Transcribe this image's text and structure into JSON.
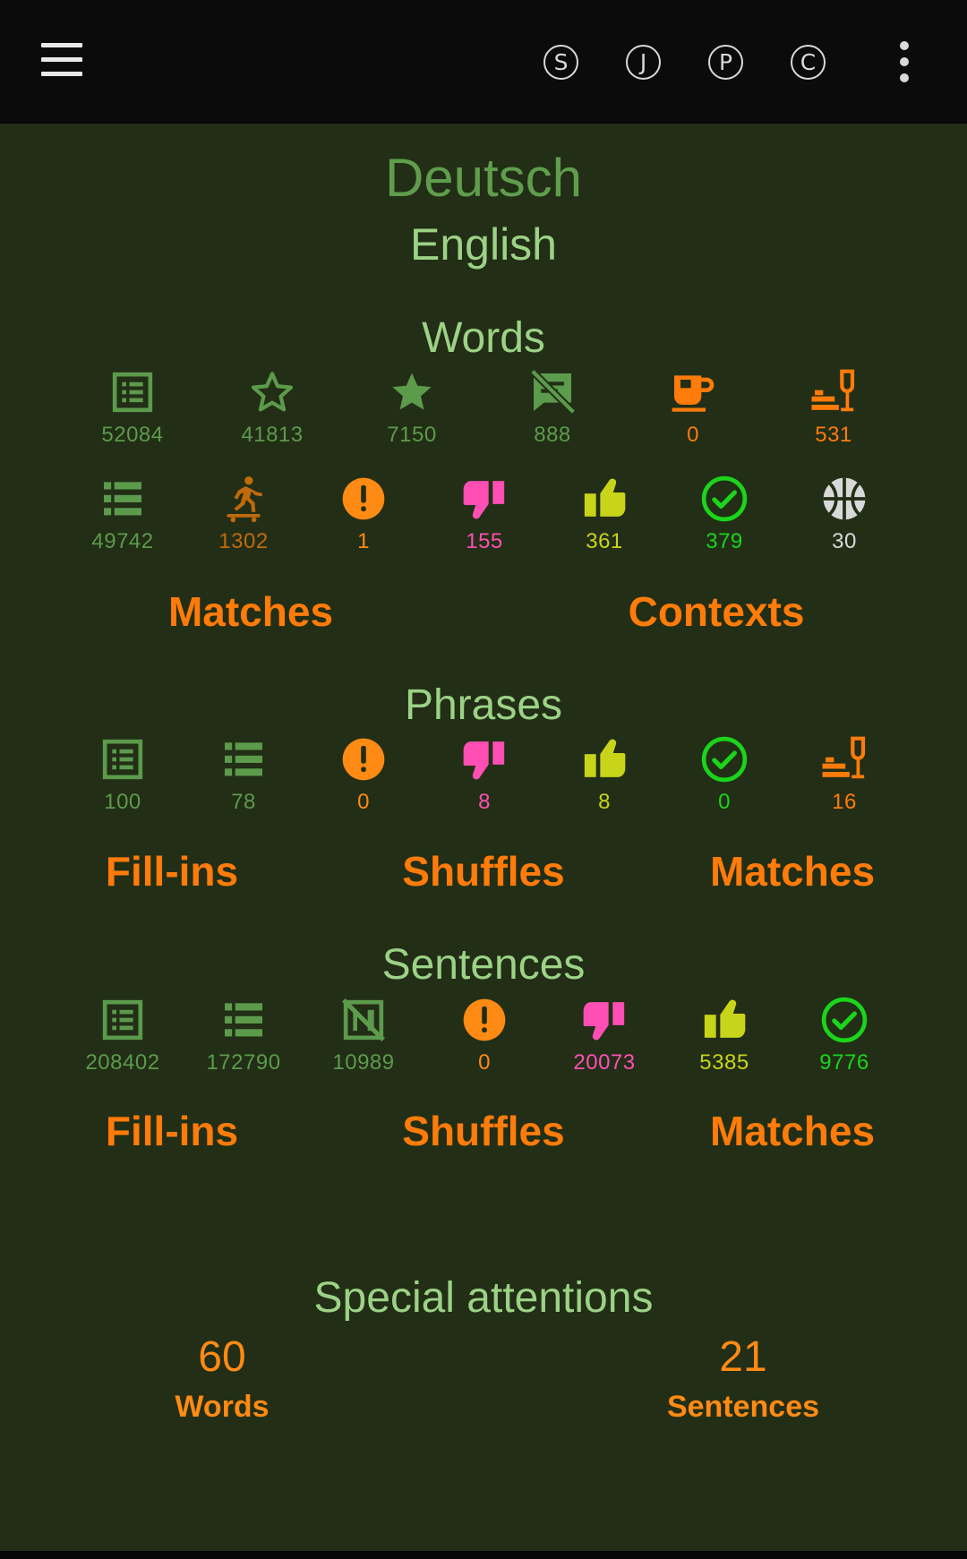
{
  "topbar": {
    "letters": [
      "S",
      "J",
      "P",
      "C"
    ]
  },
  "languages": {
    "primary": "Deutsch",
    "secondary": "English"
  },
  "words": {
    "title": "Words",
    "row1": [
      {
        "icon": "list-box-icon",
        "value": "52084",
        "color": "#5c9a4c"
      },
      {
        "icon": "star-outline-icon",
        "value": "41813",
        "color": "#5c9a4c"
      },
      {
        "icon": "star-filled-icon",
        "value": "7150",
        "color": "#5c9a4c"
      },
      {
        "icon": "comment-off-icon",
        "value": "888",
        "color": "#5c9a4c"
      },
      {
        "icon": "coffee-cup-icon",
        "value": "0",
        "color": "#ff7b0a"
      },
      {
        "icon": "bed-wine-icon",
        "value": "531",
        "color": "#ff7b0a"
      }
    ],
    "row2": [
      {
        "icon": "list-icon",
        "value": "49742",
        "color": "#5c9a4c"
      },
      {
        "icon": "skateboarder-icon",
        "value": "1302",
        "color": "#c06a0c"
      },
      {
        "icon": "alert-circle-icon",
        "value": "1",
        "color": "#ff8a14"
      },
      {
        "icon": "thumb-down-icon",
        "value": "155",
        "color": "#ff4fb5"
      },
      {
        "icon": "thumb-up-icon",
        "value": "361",
        "color": "#c8d41a"
      },
      {
        "icon": "check-circle-icon",
        "value": "379",
        "color": "#1bd41b"
      },
      {
        "icon": "basketball-icon",
        "value": "30",
        "color": "#d9d9d9"
      }
    ],
    "actions": [
      "Matches",
      "Contexts"
    ]
  },
  "phrases": {
    "title": "Phrases",
    "stats": [
      {
        "icon": "list-box-icon",
        "value": "100",
        "color": "#5c9a4c"
      },
      {
        "icon": "list-icon",
        "value": "78",
        "color": "#5c9a4c"
      },
      {
        "icon": "alert-circle-icon",
        "value": "0",
        "color": "#ff8a14"
      },
      {
        "icon": "thumb-down-icon",
        "value": "8",
        "color": "#ff4fb5"
      },
      {
        "icon": "thumb-up-icon",
        "value": "8",
        "color": "#c8d41a"
      },
      {
        "icon": "check-circle-icon",
        "value": "0",
        "color": "#1bd41b"
      },
      {
        "icon": "bed-wine-icon",
        "value": "16",
        "color": "#ff7b0a"
      }
    ],
    "actions": [
      "Fill-ins",
      "Shuffles",
      "Matches"
    ]
  },
  "sentences": {
    "title": "Sentences",
    "stats": [
      {
        "icon": "list-box-icon",
        "value": "208402",
        "color": "#5c9a4c"
      },
      {
        "icon": "list-icon",
        "value": "172790",
        "color": "#5c9a4c"
      },
      {
        "icon": "list-box-off-icon",
        "value": "10989",
        "color": "#5c9a4c"
      },
      {
        "icon": "alert-circle-icon",
        "value": "0",
        "color": "#ff8a14"
      },
      {
        "icon": "thumb-down-icon",
        "value": "20073",
        "color": "#ff4fb5"
      },
      {
        "icon": "thumb-up-icon",
        "value": "5385",
        "color": "#c8d41a"
      },
      {
        "icon": "check-circle-icon",
        "value": "9776",
        "color": "#1bd41b"
      }
    ],
    "actions": [
      "Fill-ins",
      "Shuffles",
      "Matches"
    ]
  },
  "special": {
    "title": "Special attentions",
    "words_count": "60",
    "words_label": "Words",
    "sentences_count": "21",
    "sentences_label": "Sentences"
  }
}
